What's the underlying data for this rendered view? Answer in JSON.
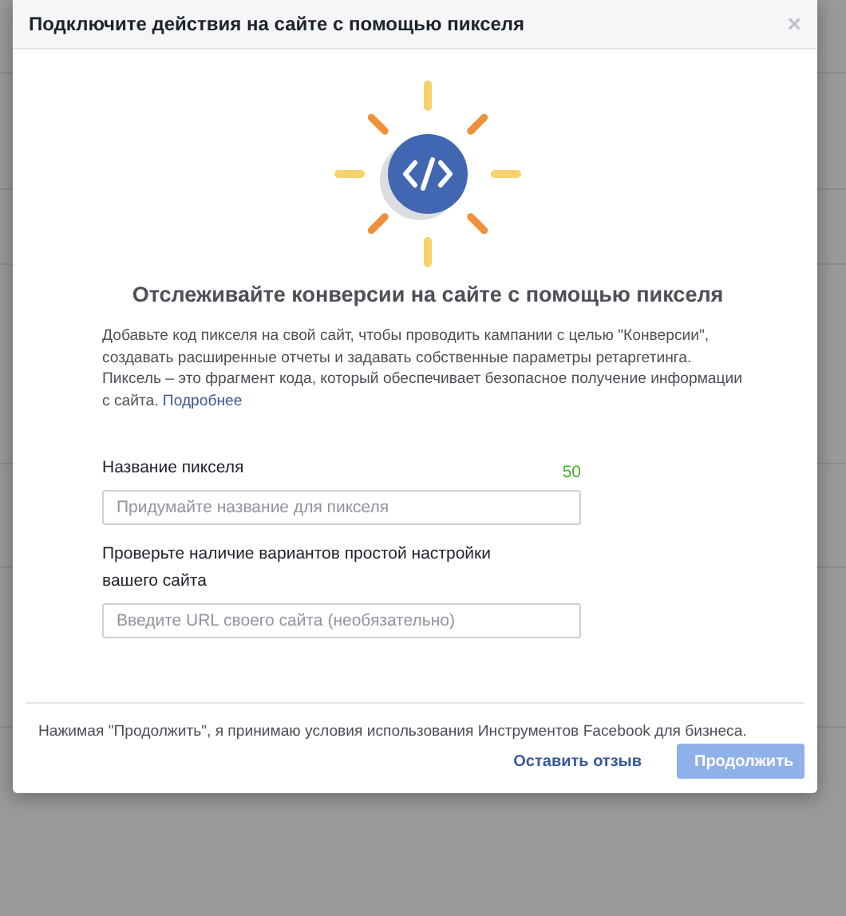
{
  "dialog": {
    "title": "Подключите действия на сайте с помощью пикселя",
    "close": "×"
  },
  "heading": "Отслеживайте конверсии на сайте с помощью пикселя",
  "description": {
    "text": "Добавьте код пикселя на свой сайт, чтобы проводить кампании с целью \"Конверсии\", создавать расширенные отчеты и задавать собственные параметры ретаргетинга. Пиксель – это фрагмент кода, который обеспечивает безопасное получение информации с сайта.",
    "link": "Подробнее"
  },
  "fields": [
    {
      "label": "Название пикселя",
      "counter": "50",
      "placeholder": "Придумайте название для пикселя"
    },
    {
      "label": "Проверьте наличие вариантов простой настройки вашего сайта",
      "placeholder": "Введите URL своего сайта (необязательно)"
    }
  ],
  "terms": "Нажимая \"Продолжить\", я принимаю условия использования Инструментов Facebook для бизнеса.",
  "buttons": [
    {
      "label": "Оставить отзыв",
      "kind": "link",
      "disabled": false
    },
    {
      "label": "Продолжить",
      "kind": "primary",
      "disabled": true
    }
  ]
}
